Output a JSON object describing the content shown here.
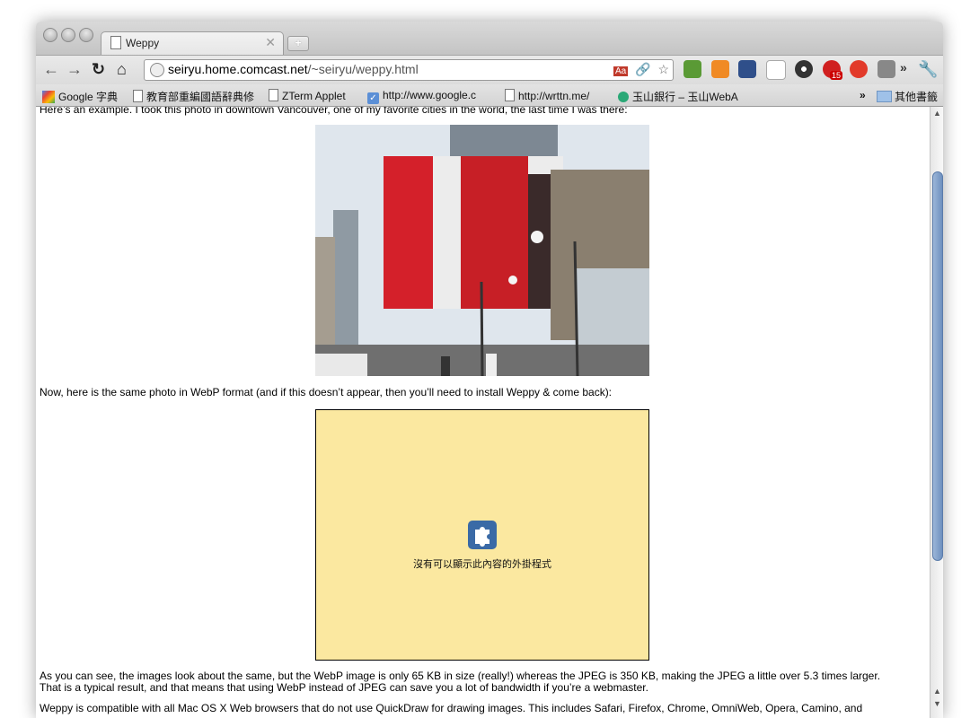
{
  "window": {
    "tab_title": "Weppy",
    "new_tab": "+"
  },
  "toolbar": {
    "url_host": "seiryu.home.comcast.net",
    "url_path": "/~seiryu/weppy.html",
    "overflow_glyph": "»"
  },
  "bookmarks": [
    {
      "label": "Google 字典",
      "icon": "google-icon"
    },
    {
      "label": "教育部重編國語辭典修",
      "icon": "page-icon"
    },
    {
      "label": "ZTerm Applet",
      "icon": "page-icon"
    },
    {
      "label": "http://www.google.c",
      "icon": "checkbox-icon"
    },
    {
      "label": "http://wrttn.me/",
      "icon": "page-icon"
    },
    {
      "label": "玉山銀行 – 玉山WebA",
      "icon": "bank-icon"
    }
  ],
  "bookmarks_overflow": "»",
  "bookmarks_other": "其他書籤",
  "extensions": {
    "calendar_badge": "15"
  },
  "content": {
    "intro": "Here’s an example. I took this photo in downtown Vancouver, one of my favorite cities in the world, the last time I was there:",
    "webp_intro": "Now, here is the same photo in WebP format (and if this doesn’t appear, then you’ll need to install Weppy & come back):",
    "plugin_message": "沒有可以顯示此內容的外掛程式",
    "paragraph1": "As you can see, the images look about the same, but the WebP image is only 65 KB in size (really!) whereas the JPEG is 350 KB, making the JPEG a little over 5.3 times larger. That is a typical result, and that means that using WebP instead of JPEG can save you a lot of bandwidth if you’re a webmaster.",
    "paragraph2": "Weppy is compatible with all Mac OS X Web browsers that do not use QuickDraw for drawing images. This includes Safari, Firefox, Chrome, OmniWeb, Opera, Camino, and"
  },
  "colors": {
    "plugin_bg": "#fbe8a0",
    "flag_red": "#d4202a",
    "scroll_thumb": "#7d9fcb"
  }
}
